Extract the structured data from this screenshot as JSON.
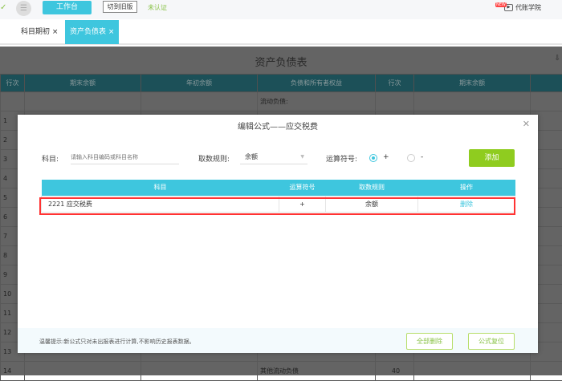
{
  "topbar": {
    "workbench": "工作台",
    "switch_old": "切到旧版",
    "unverified": "未认证",
    "new_badge": "NEW",
    "academy": "代账学院"
  },
  "tabs": [
    {
      "label": "科目期初"
    },
    {
      "label": "资产负债表"
    }
  ],
  "page": {
    "title": "资产负债表",
    "headers": [
      "行次",
      "期末余额",
      "年初余额",
      "负债和所有者权益",
      "行次",
      "期末余额"
    ],
    "rows": [
      {
        "no": "",
        "liab": "流动负债:",
        "lno": ""
      },
      {
        "no": "1",
        "liab": "",
        "lno": ""
      },
      {
        "no": "2",
        "liab": "",
        "lno": ""
      },
      {
        "no": "3",
        "liab": "",
        "lno": ""
      },
      {
        "no": "4",
        "liab": "",
        "lno": ""
      },
      {
        "no": "5",
        "liab": "",
        "lno": ""
      },
      {
        "no": "6",
        "liab": "",
        "lno": ""
      },
      {
        "no": "7",
        "liab": "",
        "lno": ""
      },
      {
        "no": "8",
        "liab": "",
        "lno": ""
      },
      {
        "no": "9",
        "liab": "",
        "lno": ""
      },
      {
        "no": "10",
        "liab": "",
        "lno": ""
      },
      {
        "no": "11",
        "liab": "",
        "lno": ""
      },
      {
        "no": "12",
        "liab": "",
        "lno": ""
      },
      {
        "no": "13",
        "liab": "",
        "lno": ""
      },
      {
        "no": "14",
        "liab": "其他流动负债",
        "lno": "40"
      }
    ]
  },
  "modal": {
    "title": "编辑公式——应交税费",
    "account_label": "科目:",
    "account_placeholder": "请输入科目编码或科目名称",
    "rule_label": "取数规则:",
    "rule_value": "余额",
    "op_label": "运算符号:",
    "op_plus": "+",
    "op_minus": "-",
    "add": "添加",
    "table": {
      "headers": [
        "科目",
        "运算符号",
        "取数规则",
        "操作"
      ],
      "rows": [
        {
          "account": "2221 应交税费",
          "op": "+",
          "rule": "余额",
          "action": "删除"
        }
      ]
    },
    "tip": "温馨提示:新公式只对未出报表进行计算,不影响历史报表数据。",
    "delete_all": "全部删除",
    "reset": "公式复位"
  }
}
